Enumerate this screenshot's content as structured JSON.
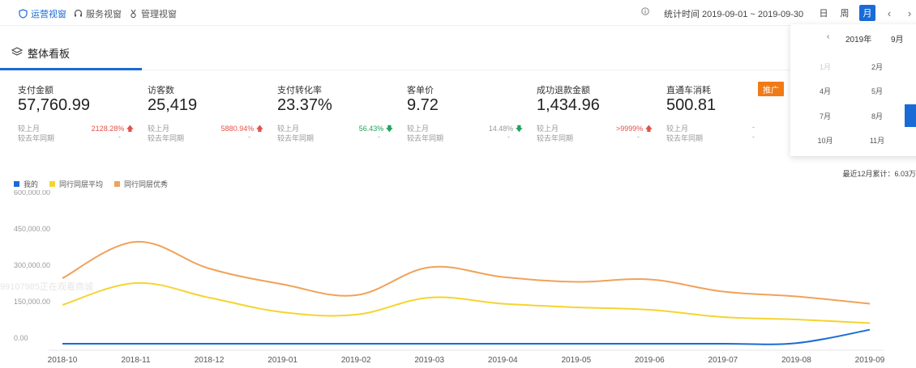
{
  "tabs": [
    {
      "label": "运营视窗",
      "active": true
    },
    {
      "label": "服务视窗",
      "active": false
    },
    {
      "label": "管理视窗",
      "active": false
    }
  ],
  "header": {
    "stat_time_label": "统计时间 2019-09-01 ~ 2019-09-30",
    "period": [
      "日",
      "周",
      "月"
    ],
    "active_period": "月",
    "prev": "‹",
    "next": "›"
  },
  "section": {
    "title": "整体看板"
  },
  "metrics": [
    {
      "label": "支付金额",
      "value": "57,760.99",
      "mom_label": "较上月",
      "mom": "2128.28%",
      "mom_dir": "up",
      "yoy_label": "较去年同期",
      "yoy": "-"
    },
    {
      "label": "访客数",
      "value": "25,419",
      "mom_label": "较上月",
      "mom": "5880.94%",
      "mom_dir": "up",
      "yoy_label": "较去年同期",
      "yoy": "-"
    },
    {
      "label": "支付转化率",
      "value": "23.37%",
      "mom_label": "较上月",
      "mom": "56.43%",
      "mom_dir": "down",
      "yoy_label": "较去年同期",
      "yoy": "-"
    },
    {
      "label": "客单价",
      "value": "9.72",
      "mom_label": "较上月",
      "mom": "14.48%",
      "mom_dir": "down",
      "yoy_label": "较去年同期",
      "yoy": "-"
    },
    {
      "label": "成功退款金额",
      "value": "1,434.96",
      "mom_label": "较上月",
      "mom": ">9999%",
      "mom_dir": "up",
      "yoy_label": "较去年同期",
      "yoy": "-"
    },
    {
      "label": "直通车消耗",
      "value": "500.81",
      "mom_label": "较上月",
      "mom": "-",
      "mom_dir": "",
      "yoy_label": "较去年同期",
      "yoy": "-"
    }
  ],
  "promo_badge": "推广",
  "calendar": {
    "prev": "‹",
    "year": "2019年",
    "month": "9月",
    "months": [
      "1月",
      "2月",
      "4月",
      "5月",
      "7月",
      "8月",
      "10月",
      "11月"
    ]
  },
  "cumulative": "最近12月累计：6.03万",
  "legend": [
    {
      "label": "我的",
      "color": "#1a6bd6"
    },
    {
      "label": "同行同层平均",
      "color": "#f5d431"
    },
    {
      "label": "同行同层优秀",
      "color": "#f0a259"
    }
  ],
  "watermark": "99107985正在观看商城",
  "chart_data": {
    "type": "line",
    "categories": [
      "2018-10",
      "2018-11",
      "2018-12",
      "2019-01",
      "2019-02",
      "2019-03",
      "2019-04",
      "2019-05",
      "2019-06",
      "2019-07",
      "2019-08",
      "2019-09"
    ],
    "y_ticks": [
      "0.00",
      "150,000.00",
      "300,000.00",
      "450,000.00",
      "600,000.00"
    ],
    "ylim": [
      0,
      600000
    ],
    "series": [
      {
        "name": "我的",
        "color": "#1a6bd6",
        "values": [
          0,
          0,
          0,
          0,
          0,
          0,
          0,
          0,
          0,
          0,
          2600,
          57761
        ]
      },
      {
        "name": "同行同层平均",
        "color": "#f5d431",
        "values": [
          160000,
          250000,
          190000,
          130000,
          120000,
          190000,
          165000,
          150000,
          140000,
          110000,
          100000,
          85000
        ]
      },
      {
        "name": "同行同层优秀",
        "color": "#f0a259",
        "values": [
          270000,
          420000,
          310000,
          245000,
          200000,
          315000,
          275000,
          255000,
          265000,
          215000,
          195000,
          165000
        ]
      }
    ]
  }
}
